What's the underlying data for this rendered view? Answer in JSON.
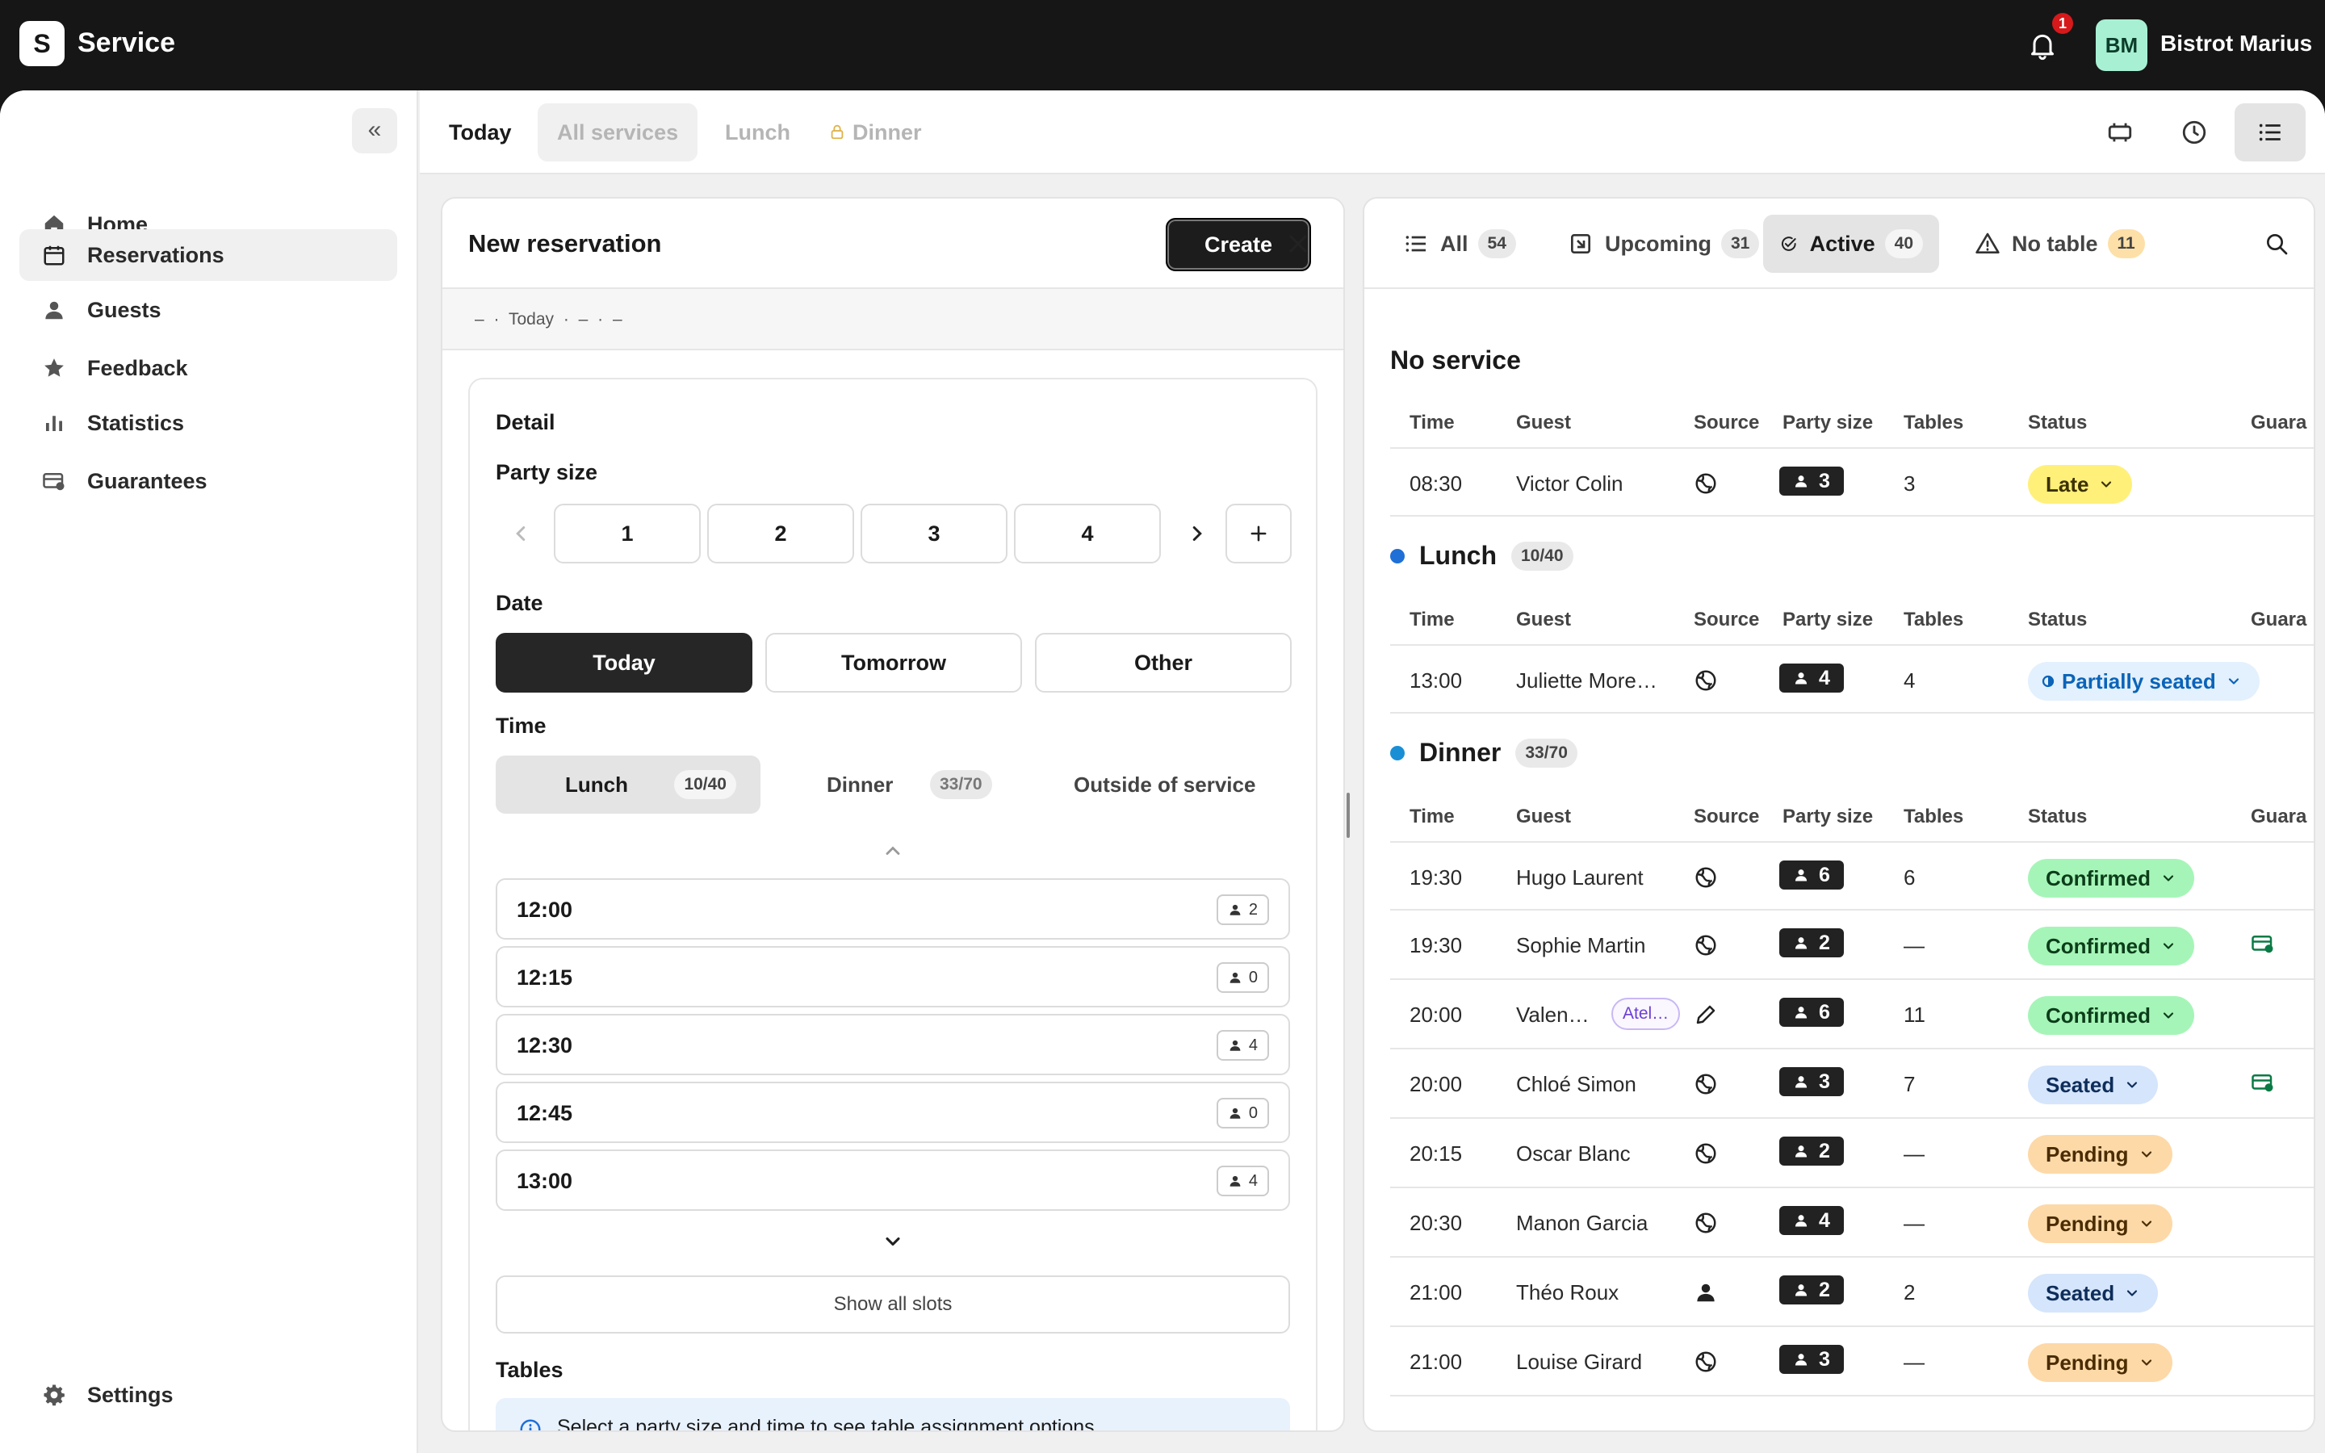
{
  "app": {
    "logo_letter": "S",
    "title": "Service",
    "notif_count": "1",
    "avatar_initials": "BM",
    "user_name": "Bistrot Marius"
  },
  "sidebar": {
    "items": [
      {
        "label": "Home",
        "icon": "home-icon"
      },
      {
        "label": "Reservations",
        "icon": "calendar-icon",
        "active": true
      },
      {
        "label": "Guests",
        "icon": "person-icon"
      },
      {
        "label": "Feedback",
        "icon": "star-icon"
      },
      {
        "label": "Statistics",
        "icon": "bar-chart-icon"
      },
      {
        "label": "Guarantees",
        "icon": "card-icon"
      }
    ],
    "settings_label": "Settings"
  },
  "toolbar": {
    "today": "Today",
    "all_services": "All services",
    "lunch": "Lunch",
    "dinner": "Dinner"
  },
  "new_reservation": {
    "title": "New reservation",
    "create_label": "Create",
    "summary": "– · Today · – · –",
    "detail_label": "Detail",
    "party_size_label": "Party size",
    "party_sizes": [
      "1",
      "2",
      "3",
      "4"
    ],
    "date_label": "Date",
    "dates": [
      "Today",
      "Tomorrow",
      "Other"
    ],
    "time_label": "Time",
    "services": [
      {
        "name": "Lunch",
        "count": "10/40"
      },
      {
        "name": "Dinner",
        "count": "33/70"
      },
      {
        "name": "Outside of service",
        "count": ""
      }
    ],
    "slots": [
      {
        "time": "12:00",
        "count": "2"
      },
      {
        "time": "12:15",
        "count": "0"
      },
      {
        "time": "12:30",
        "count": "4"
      },
      {
        "time": "12:45",
        "count": "0"
      },
      {
        "time": "13:00",
        "count": "4"
      }
    ],
    "show_all": "Show all slots",
    "tables_label": "Tables",
    "tables_info": "Select a party size and time to see table assignment options"
  },
  "list_tabs": [
    {
      "label": "All",
      "count": "54"
    },
    {
      "label": "Upcoming",
      "count": "31"
    },
    {
      "label": "Active",
      "count": "40"
    },
    {
      "label": "No table",
      "count": "11"
    }
  ],
  "columns": {
    "time": "Time",
    "guest": "Guest",
    "source": "Source",
    "party": "Party size",
    "tables": "Tables",
    "status": "Status",
    "guarantee": "Guara"
  },
  "sections": {
    "no_service": {
      "title": "No service"
    },
    "lunch": {
      "title": "Lunch",
      "count": "10/40",
      "color": "#1f6fd6"
    },
    "dinner": {
      "title": "Dinner",
      "count": "33/70",
      "color": "#1a8fd6"
    }
  },
  "reservations": {
    "no_service": [
      {
        "time": "08:30",
        "guest": "Victor Colin",
        "party": "3",
        "tables": "3",
        "status": "Late"
      }
    ],
    "lunch": [
      {
        "time": "13:00",
        "guest": "Juliette More…",
        "party": "4",
        "tables": "4",
        "status": "Partially seated"
      }
    ],
    "dinner": [
      {
        "time": "19:30",
        "guest": "Hugo Laurent",
        "party": "6",
        "tables": "6",
        "status": "Confirmed"
      },
      {
        "time": "19:30",
        "guest": "Sophie Martin",
        "party": "2",
        "tables": "—",
        "status": "Confirmed"
      },
      {
        "time": "20:00",
        "guest": "Valen…",
        "tag": "Atel…",
        "party": "6",
        "tables": "11",
        "status": "Confirmed"
      },
      {
        "time": "20:00",
        "guest": "Chloé Simon",
        "party": "3",
        "tables": "7",
        "status": "Seated"
      },
      {
        "time": "20:15",
        "guest": "Oscar Blanc",
        "party": "2",
        "tables": "—",
        "status": "Pending"
      },
      {
        "time": "20:30",
        "guest": "Manon Garcia",
        "party": "4",
        "tables": "—",
        "status": "Pending"
      },
      {
        "time": "21:00",
        "guest": "Théo Roux",
        "party": "2",
        "tables": "2",
        "status": "Seated"
      },
      {
        "time": "21:00",
        "guest": "Louise Girard",
        "party": "3",
        "tables": "—",
        "status": "Pending"
      }
    ]
  }
}
